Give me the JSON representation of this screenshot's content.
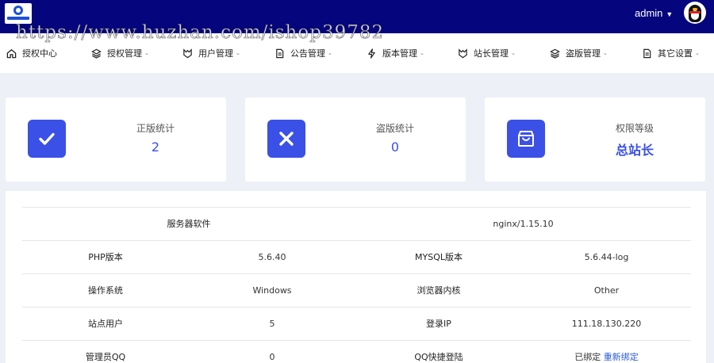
{
  "header": {
    "username": "admin"
  },
  "watermark": "https://www.huzhan.com/ishop39782",
  "nav": [
    {
      "label": "授权中心",
      "icon": "home-icon",
      "dropdown": false
    },
    {
      "label": "授权管理",
      "icon": "layers-icon",
      "dropdown": true
    },
    {
      "label": "用户管理",
      "icon": "users-icon",
      "dropdown": true
    },
    {
      "label": "公告管理",
      "icon": "document-icon",
      "dropdown": true
    },
    {
      "label": "版本管理",
      "icon": "lightning-icon",
      "dropdown": true
    },
    {
      "label": "站长管理",
      "icon": "crown-icon",
      "dropdown": true
    },
    {
      "label": "盗版管理",
      "icon": "stack-icon",
      "dropdown": true
    },
    {
      "label": "其它设置",
      "icon": "file-icon",
      "dropdown": true
    }
  ],
  "stats": [
    {
      "label": "正版统计",
      "value": "2",
      "icon": "check-icon"
    },
    {
      "label": "盗版统计",
      "value": "0",
      "icon": "close-icon"
    },
    {
      "label": "权限等级",
      "value": "总站长",
      "icon": "shopping-bag-icon"
    }
  ],
  "server_info": {
    "server_software_label": "服务器软件",
    "server_software_value": "nginx/1.15.10",
    "rows": [
      {
        "k1": "PHP版本",
        "v1": "5.6.40",
        "k2": "MYSQL版本",
        "v2": "5.6.44-log"
      },
      {
        "k1": "操作系统",
        "v1": "Windows",
        "k2": "浏览器内核",
        "v2": "Other"
      },
      {
        "k1": "站点用户",
        "v1": "5",
        "k2": "登录IP",
        "v2": "111.18.130.220"
      },
      {
        "k1": "管理员QQ",
        "v1": "0",
        "k2": "QQ快捷登陆",
        "v2": "已绑定",
        "v2_link": "重新绑定"
      }
    ]
  },
  "colors": {
    "topbar": "#05057d",
    "accent": "#3a50e6",
    "link": "#2a5bd7"
  }
}
